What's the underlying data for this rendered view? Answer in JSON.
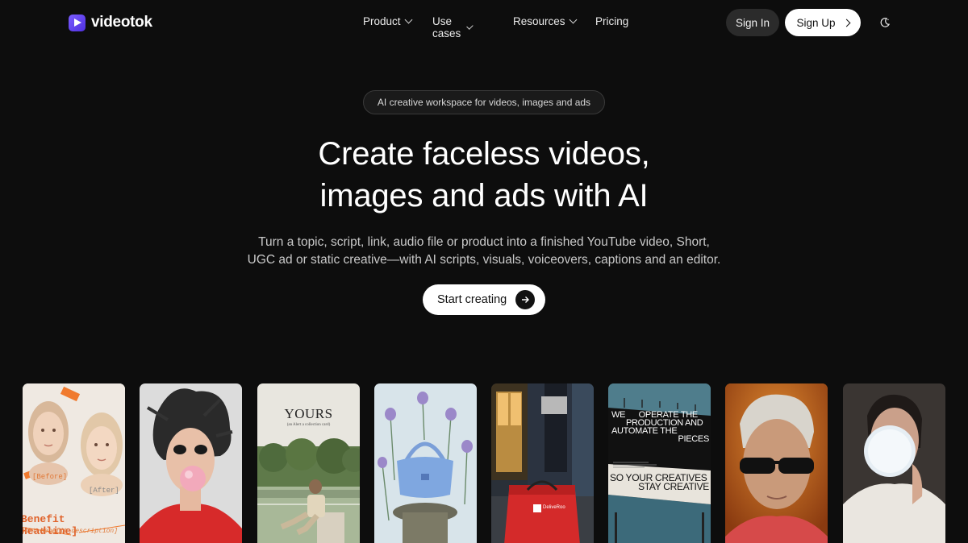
{
  "brand": {
    "name": "videotok",
    "accent": "#6a45f5"
  },
  "nav": {
    "items": [
      {
        "label": "Product",
        "has_dropdown": true
      },
      {
        "label": "Use cases",
        "has_dropdown": true
      },
      {
        "label": "Resources",
        "has_dropdown": true
      },
      {
        "label": "Pricing",
        "has_dropdown": false
      }
    ],
    "sign_in": "Sign In",
    "sign_up": "Sign Up",
    "theme_icon": "moon-icon"
  },
  "hero": {
    "badge": "AI creative workspace for videos, images and ads",
    "headline_line1": "Create faceless videos,",
    "headline_line2": "images and ads with AI",
    "sub_line1": "Turn a topic, script, link, audio file or product into a finished YouTube video, Short,",
    "sub_line2": "UGC ad or static creative—with AI scripts, visuals, voiceovers, captions and an editor.",
    "cta": "Start creating"
  },
  "gallery": {
    "card1": {
      "before": "[Before]",
      "after": "[After]",
      "headline": "Benefit Headline]",
      "desc": "hort benefit description]"
    },
    "card3": {
      "title": "YOURS",
      "subtitle": "(an Alert a collection card)"
    },
    "card6": {
      "text1_l1": "WE      OPERATE THE",
      "text1_l2": "PRODUCTION AND",
      "text1_l3": "AUTOMATE THE",
      "text1_l4": "PIECES",
      "text2_l1": "SO YOUR CREATIVES",
      "text2_l2": "STAY CREATIVE"
    },
    "card5": {
      "bag_brand": "DeliveRoo"
    }
  }
}
